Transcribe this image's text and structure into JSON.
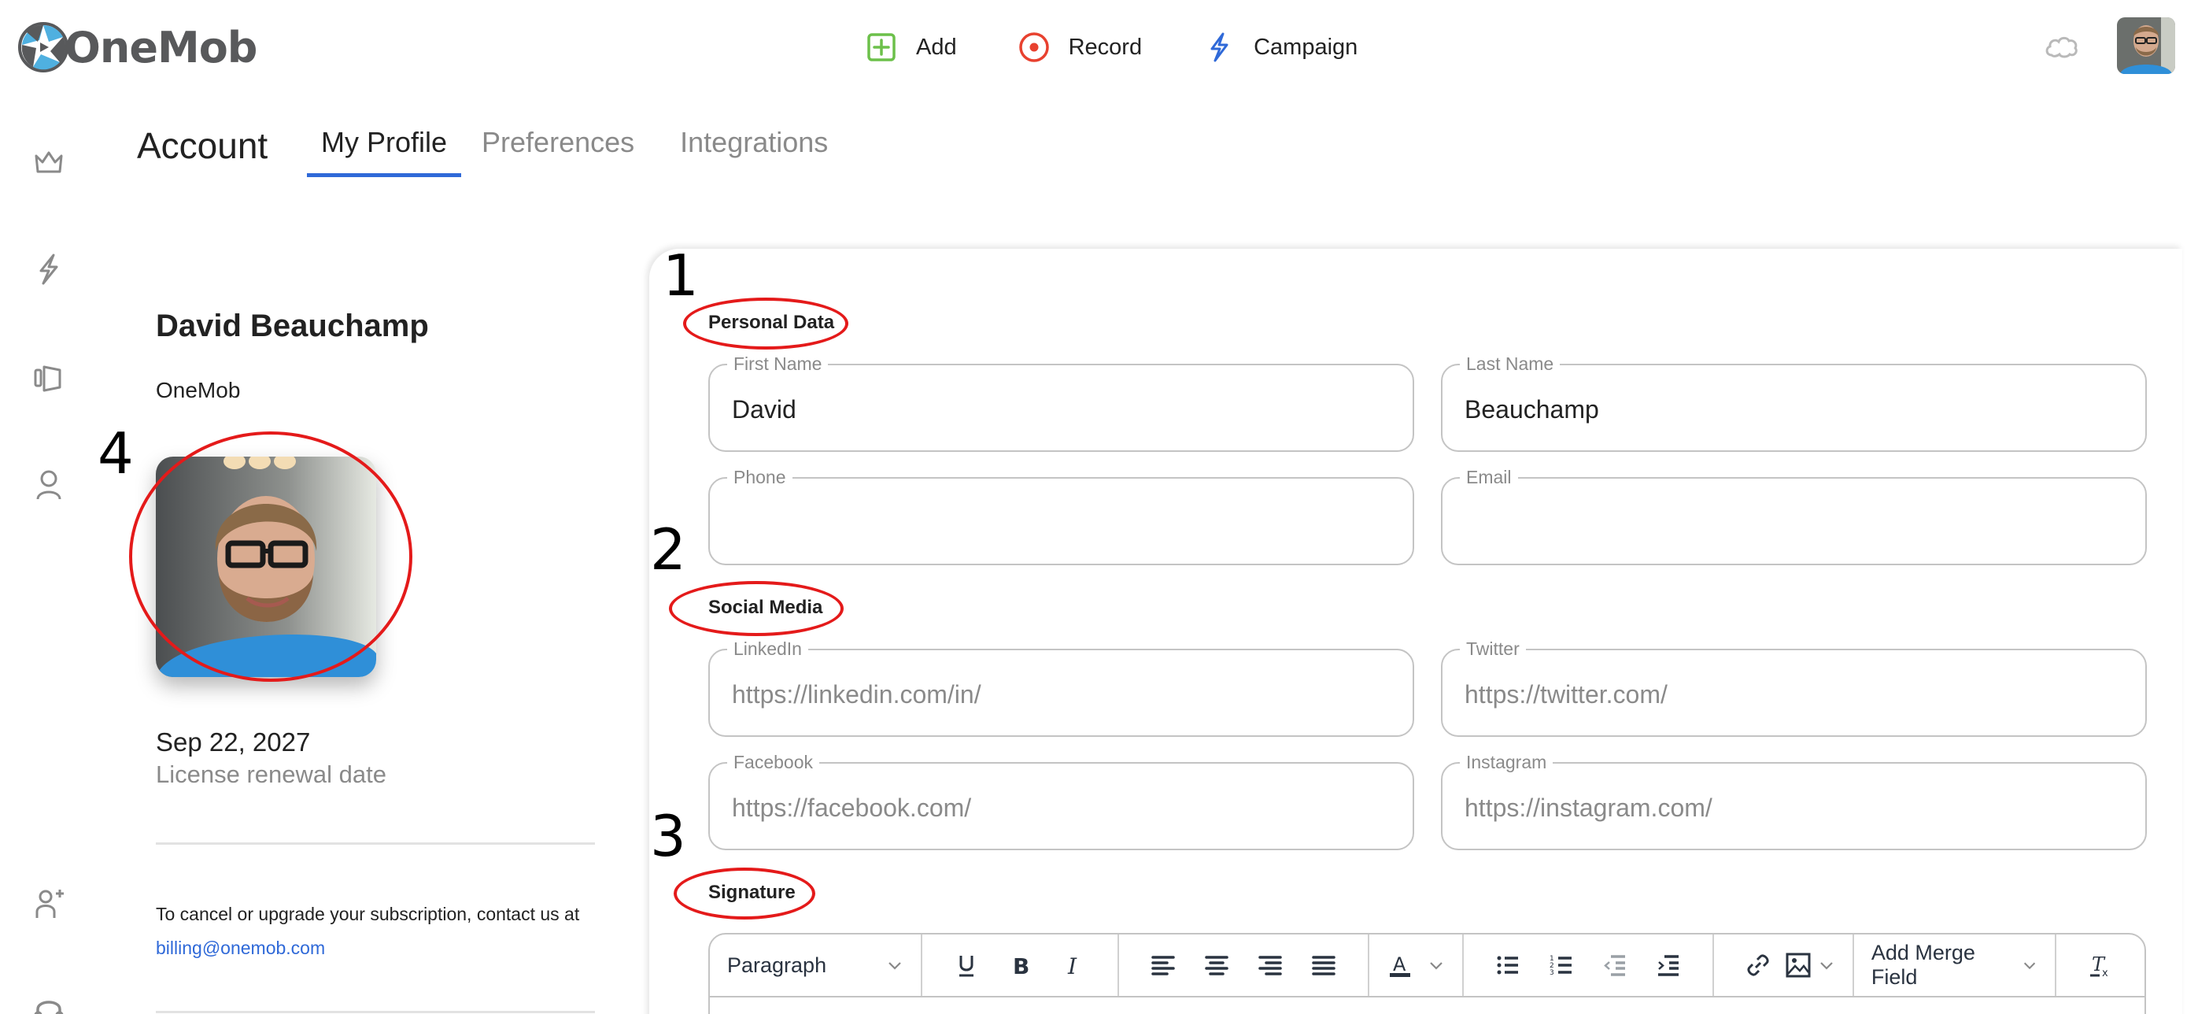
{
  "app": {
    "name": "OneMob"
  },
  "topnav": {
    "items": [
      {
        "label": "Add",
        "icon": "plus-square-icon",
        "color": "#6cc04a"
      },
      {
        "label": "Record",
        "icon": "record-icon",
        "color": "#e8412f"
      },
      {
        "label": "Campaign",
        "icon": "lightning-icon",
        "color": "#2f69d8"
      }
    ]
  },
  "header": {
    "title": "Account",
    "tabs": [
      {
        "label": "My Profile",
        "active": true
      },
      {
        "label": "Preferences",
        "active": false
      },
      {
        "label": "Integrations",
        "active": false
      }
    ]
  },
  "rail": {
    "icons": [
      "crown-icon",
      "lightning-icon",
      "library-icon",
      "user-icon",
      "add-user-icon",
      "headset-icon"
    ]
  },
  "profile": {
    "name": "David Beauchamp",
    "company": "OneMob",
    "license_date": "Sep 22, 2027",
    "license_label": "License renewal date",
    "billing_text": "To cancel or upgrade your subscription, contact us at ",
    "billing_email": "billing@onemob.com"
  },
  "annotations": {
    "n1": "1",
    "n2": "2",
    "n3": "3",
    "n4": "4"
  },
  "form": {
    "personal": {
      "title": "Personal Data",
      "first_name": {
        "label": "First Name",
        "value": "David",
        "placeholder": ""
      },
      "last_name": {
        "label": "Last Name",
        "value": "Beauchamp",
        "placeholder": ""
      },
      "phone": {
        "label": "Phone",
        "value": "",
        "placeholder": ""
      },
      "email": {
        "label": "Email",
        "value": "",
        "placeholder": ""
      }
    },
    "social": {
      "title": "Social Media",
      "linkedin": {
        "label": "LinkedIn",
        "value": "",
        "placeholder": "https://linkedin.com/in/"
      },
      "twitter": {
        "label": "Twitter",
        "value": "",
        "placeholder": "https://twitter.com/"
      },
      "facebook": {
        "label": "Facebook",
        "value": "",
        "placeholder": "https://facebook.com/"
      },
      "instagram": {
        "label": "Instagram",
        "value": "",
        "placeholder": "https://instagram.com/"
      }
    },
    "signature": {
      "title": "Signature",
      "block_format": "Paragraph",
      "merge_field_label": "Add Merge Field"
    }
  },
  "colors": {
    "accent": "#2f69d8",
    "annotation": "#e41a1a",
    "logo_blue": "#4fb0e0",
    "logo_gray": "#58595b"
  }
}
